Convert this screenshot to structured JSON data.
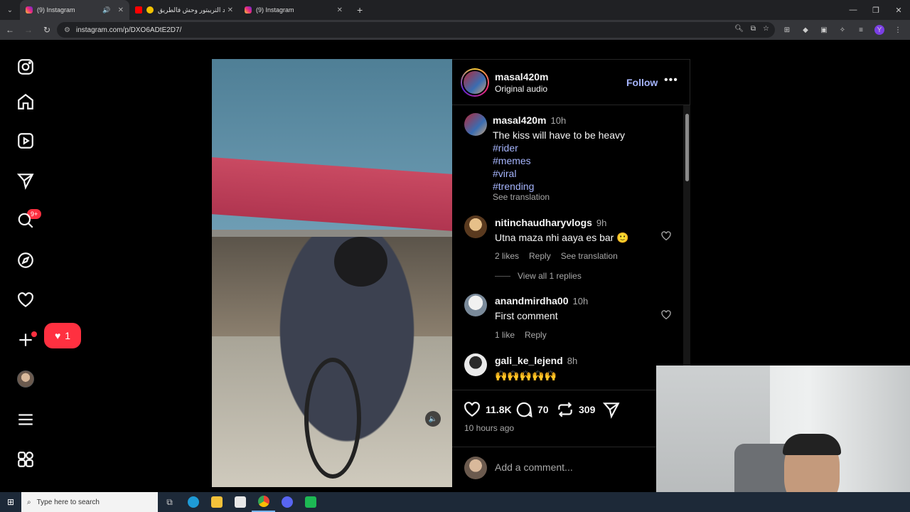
{
  "browser": {
    "tabs": [
      {
        "title": "(9) Instagram",
        "active": true
      },
      {
        "title": "هاد التريبتور وحش فالطريق",
        "active": false
      },
      {
        "title": "(9) Instagram",
        "active": false
      }
    ],
    "new_tab": "+",
    "url": "instagram.com/p/DXO6ADtE2D7/"
  },
  "sidebar": {
    "notification_badge": "9+",
    "like_notification_count": "1"
  },
  "post": {
    "username": "masal420m",
    "audio": "Original audio",
    "follow_label": "Follow",
    "caption": {
      "username": "masal420m",
      "time": "10h",
      "text": "The kiss will have to be heavy",
      "hashtags": [
        "#rider",
        "#memes",
        "#viral",
        "#trending"
      ],
      "see_translation": "See translation"
    },
    "comments": [
      {
        "username": "nitinchaudharyvlogs",
        "time": "9h",
        "text": "Utna maza nhi aaya es bar 🙂",
        "likes": "2 likes",
        "reply": "Reply",
        "see_translation": "See translation"
      },
      {
        "username": "anandmirdha00",
        "time": "10h",
        "text": "First comment",
        "likes": "1 like",
        "reply": "Reply"
      },
      {
        "username": "gali_ke_lejend",
        "time": "8h",
        "text": "🙌🙌🙌🙌🙌"
      }
    ],
    "view_replies": "View all 1 replies",
    "stats": {
      "likes": "11.8K",
      "comments": "70",
      "reposts": "309"
    },
    "posted_ago": "10 hours ago",
    "add_comment_placeholder": "Add a comment..."
  },
  "taskbar": {
    "search_placeholder": "Type here to search"
  }
}
